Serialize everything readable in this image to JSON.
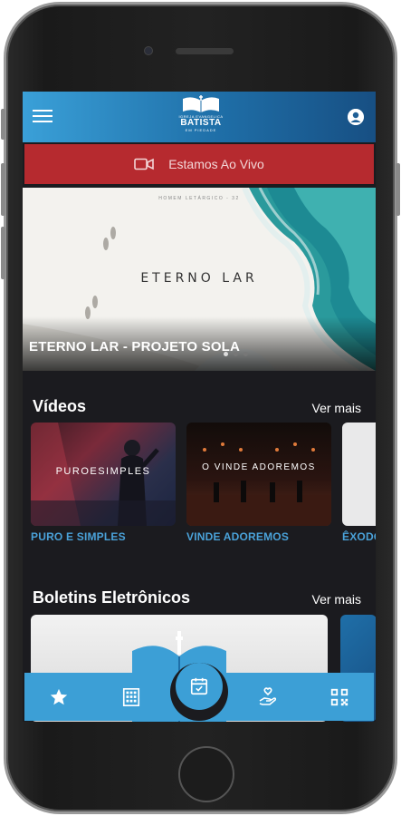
{
  "header": {
    "logo_top": "IGREJA EVANGELICA",
    "logo_main": "BATISTA",
    "logo_bottom": "EM PIEDADE"
  },
  "live": {
    "label": "Estamos Ao Vivo"
  },
  "hero": {
    "small_text": "HOMEM LETÁRGICO - 32",
    "image_title": "ETERNO LAR",
    "caption": "ETERNO LAR - PROJETO SOLA",
    "slide_count": 3,
    "active_slide": 1
  },
  "videos": {
    "title": "Vídeos",
    "see_more": "Ver mais",
    "items": [
      {
        "thumb_text": "PUROESIMPLES",
        "label": "PURO E SIMPLES"
      },
      {
        "thumb_text": "O VINDE ADOREMOS",
        "label": "VINDE ADOREMOS"
      },
      {
        "thumb_text": "",
        "label": "ÊXODO"
      }
    ]
  },
  "bulletins": {
    "title": "Boletins Eletrônicos",
    "see_more": "Ver mais"
  },
  "bottom_nav": {
    "items": [
      "star-icon",
      "building-icon",
      "calendar-icon",
      "charity-hand-icon",
      "qr-code-icon"
    ],
    "active": "calendar-icon"
  },
  "colors": {
    "brand_blue": "#3c9fd6",
    "live_red": "#b62a2f",
    "label_blue": "#4aa2d9",
    "background": "#1b1b1f"
  }
}
